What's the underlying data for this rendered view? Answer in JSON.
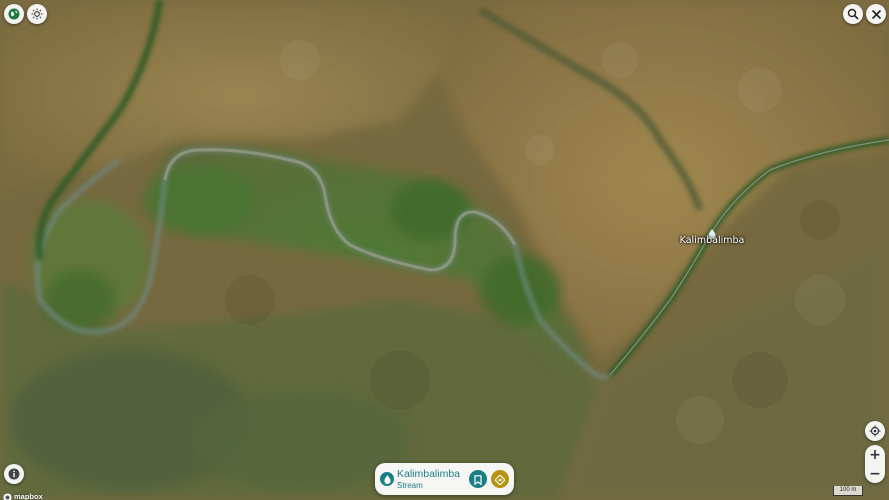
{
  "map": {
    "base_color": "#7a6a3e",
    "vegetation_color": "#3f6b2c",
    "river_color": "#5f7f78"
  },
  "top_left_controls": {
    "layers_icon": "globe-icon",
    "style_icon": "sun-icon"
  },
  "top_right_controls": {
    "search_icon": "search-icon",
    "close_icon": "close-icon"
  },
  "poi": {
    "label": "Kalimbalimba",
    "icon": "water-drop-icon"
  },
  "place_card": {
    "title": "Kalimbalimba",
    "subtitle": "Stream",
    "type_icon": "water-drop-icon",
    "action_1_icon": "bookmark-icon",
    "action_2_icon": "directions-icon",
    "accent_color": "#1d7f86",
    "action_2_color": "#b7930f"
  },
  "zoom": {
    "in_label": "+",
    "out_label": "−"
  },
  "locate_icon": "crosshair-icon",
  "info_icon": "info-icon",
  "brand": {
    "label": "mapbox"
  },
  "scale": {
    "label": "100 m"
  }
}
